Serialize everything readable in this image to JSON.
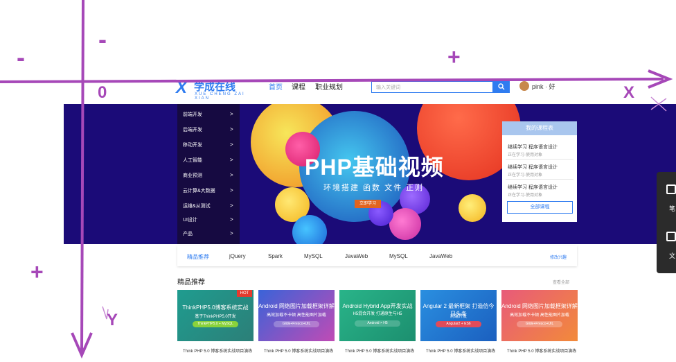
{
  "header": {
    "logo_mark": "X",
    "logo_text": "学成在线",
    "logo_sub": "XUE CHENG ZAI XIAN",
    "nav": [
      "首页",
      "课程",
      "职业规划"
    ],
    "search_placeholder": "输入关键词",
    "search_icon": "search-icon",
    "username": "pink · 好"
  },
  "banner": {
    "menu": [
      "前端开发",
      "后端开发",
      "移动开发",
      "人工智能",
      "商业预测",
      "云计算&大数据",
      "运维&从测试",
      "UI设计",
      "产品"
    ],
    "arrow": ">",
    "title": "PHP基础视频",
    "subtitle": "环境搭建  函数  文件  正则",
    "button": "立即学习"
  },
  "course_panel": {
    "title": "我的课程表",
    "items": [
      {
        "name": "继续学习 程序语言设计",
        "sub": "正在学习-使用对象"
      },
      {
        "name": "继续学习 程序语言设计",
        "sub": "正在学习-使用对象"
      },
      {
        "name": "继续学习 程序语言设计",
        "sub": "正在学习-使用对象"
      }
    ],
    "all_button": "全部课程"
  },
  "float_bar": {
    "items": [
      "笔",
      "文"
    ]
  },
  "tags": {
    "items": [
      "精品推荐",
      "jQuery",
      "Spark",
      "MySQL",
      "JavaWeb",
      "MySQL",
      "JavaWeb"
    ],
    "more": "修改兴趣"
  },
  "featured": {
    "title": "精品推荐",
    "more": "查看全部",
    "hot": "HOT",
    "cards": [
      {
        "line1": "ThinkPHP5.0博客系统实战",
        "line2": "基于ThinkPHP5.0开发",
        "pill": "ThinkPHP5.0 + MySQL",
        "caption": "Think PHP 5.0 博客系统实战项目演练"
      },
      {
        "line1": "Android 网络图片加载框架详解",
        "line2": "高效加载不卡顿 高性能图片加载",
        "pill": "Glide+Fresco+UIL",
        "caption": "Think PHP 5.0 博客系统实战项目演练"
      },
      {
        "line1": "Android Hybrid App开发实战",
        "line2": "H5混合开发 打通原生与H5",
        "pill": "Android × H5",
        "caption": "Think PHP 5.0 博客系统实战项目演练"
      },
      {
        "line1": "Angular 2 最新框架 打造仿今日头条",
        "line2": "前端开发",
        "pill": "Angular2 + ES6",
        "caption": "Think PHP 5.0 博客系统实战项目演练"
      },
      {
        "line1": "Android 网络图片加载框架详解",
        "line2": "高效加载不卡顿 高性能图片加载",
        "pill": "Glide+Fresco+UIL",
        "caption": "Think PHP 5.0 博客系统实战项目演练"
      }
    ]
  },
  "annotations": {
    "origin": "0",
    "x_label": "X",
    "y_label": "Y",
    "minus": "-",
    "plus": "+"
  }
}
